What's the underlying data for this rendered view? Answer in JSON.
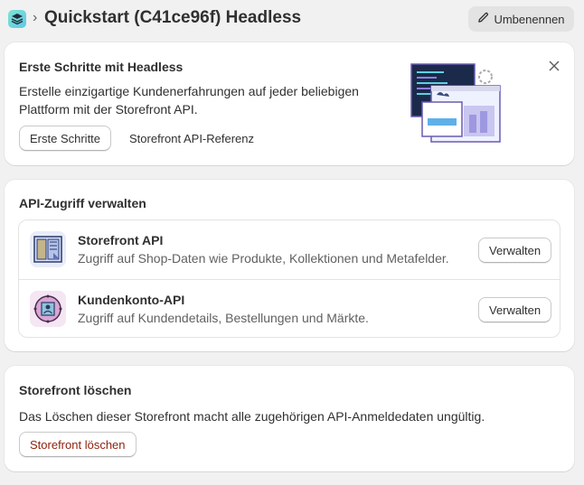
{
  "header": {
    "title": "Quickstart (C41ce96f) Headless",
    "rename_label": "Umbenennen",
    "app_icon": "layers-icon",
    "separator": "›"
  },
  "intro_card": {
    "title": "Erste Schritte mit Headless",
    "description_line1": "Erstelle einzigartige Kundenerfahrungen auf jeder beliebigen",
    "description_line2": "Plattform mit der Storefront API.",
    "primary_button": "Erste Schritte",
    "secondary_link": "Storefront API-Referenz",
    "close_icon": "close-icon"
  },
  "api_card": {
    "title": "API-Zugriff verwalten",
    "items": [
      {
        "name": "Storefront API",
        "description": "Zugriff auf Shop-Daten wie Produkte, Kollektionen und Metafelder.",
        "button": "Verwalten",
        "icon": "storefront-icon"
      },
      {
        "name": "Kundenkonto-API",
        "description": "Zugriff auf Kundendetails, Bestellungen und Märkte.",
        "button": "Verwalten",
        "icon": "customer-account-icon"
      }
    ]
  },
  "delete_card": {
    "title": "Storefront löschen",
    "description": "Das Löschen dieser Storefront macht alle zugehörigen API-Anmeldedaten ungültig.",
    "button": "Storefront löschen"
  },
  "colors": {
    "background": "#f1f1f1",
    "card": "#ffffff",
    "danger": "#8e1f0b",
    "text": "#303030",
    "subdued": "#616161"
  }
}
